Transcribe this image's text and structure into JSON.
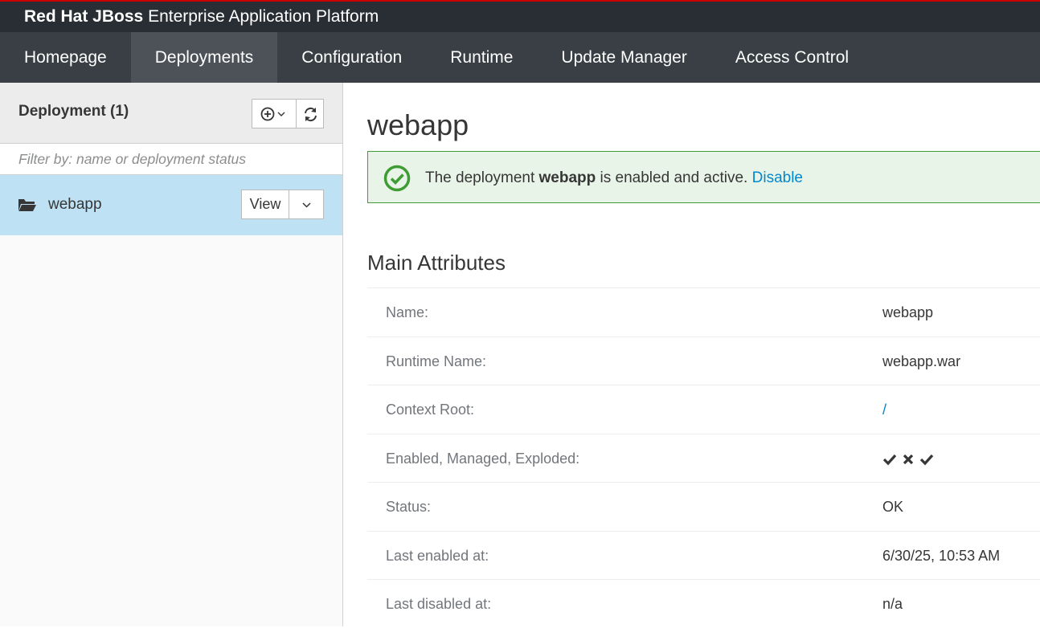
{
  "brand": {
    "bold": "Red Hat JBoss",
    "rest": "Enterprise Application Platform"
  },
  "nav": [
    {
      "label": "Homepage",
      "active": false
    },
    {
      "label": "Deployments",
      "active": true
    },
    {
      "label": "Configuration",
      "active": false
    },
    {
      "label": "Runtime",
      "active": false
    },
    {
      "label": "Update Manager",
      "active": false
    },
    {
      "label": "Access Control",
      "active": false
    }
  ],
  "sidebar": {
    "title": "Deployment (1)",
    "add_icon": "plus-circle-icon",
    "refresh_icon": "refresh-icon",
    "filter_placeholder": "Filter by: name or deployment status",
    "items": [
      {
        "icon": "folder-open-icon",
        "label": "webapp",
        "view_label": "View"
      }
    ]
  },
  "main": {
    "title": "webapp",
    "alert": {
      "icon": "check-circle-icon",
      "prefix": "The deployment ",
      "name": "webapp",
      "suffix": " is enabled and active. ",
      "link": "Disable",
      "color": "#3f9c35"
    },
    "section_title": "Main Attributes",
    "attributes": [
      {
        "key": "Name:",
        "value": "webapp"
      },
      {
        "key": "Runtime Name:",
        "value": "webapp.war"
      },
      {
        "key": "Context Root:",
        "value": "/",
        "link": true
      },
      {
        "key": "Enabled, Managed, Exploded:",
        "flags": [
          "check",
          "cross",
          "check"
        ]
      },
      {
        "key": "Status:",
        "value": "OK"
      },
      {
        "key": "Last enabled at:",
        "value": "6/30/25, 10:53 AM"
      },
      {
        "key": "Last disabled at:",
        "value": "n/a"
      }
    ]
  },
  "colors": {
    "accent": "#0088ce",
    "nav_bg": "#393f44",
    "topbar_bg": "#292e34",
    "selected_row": "#bee1f4"
  }
}
